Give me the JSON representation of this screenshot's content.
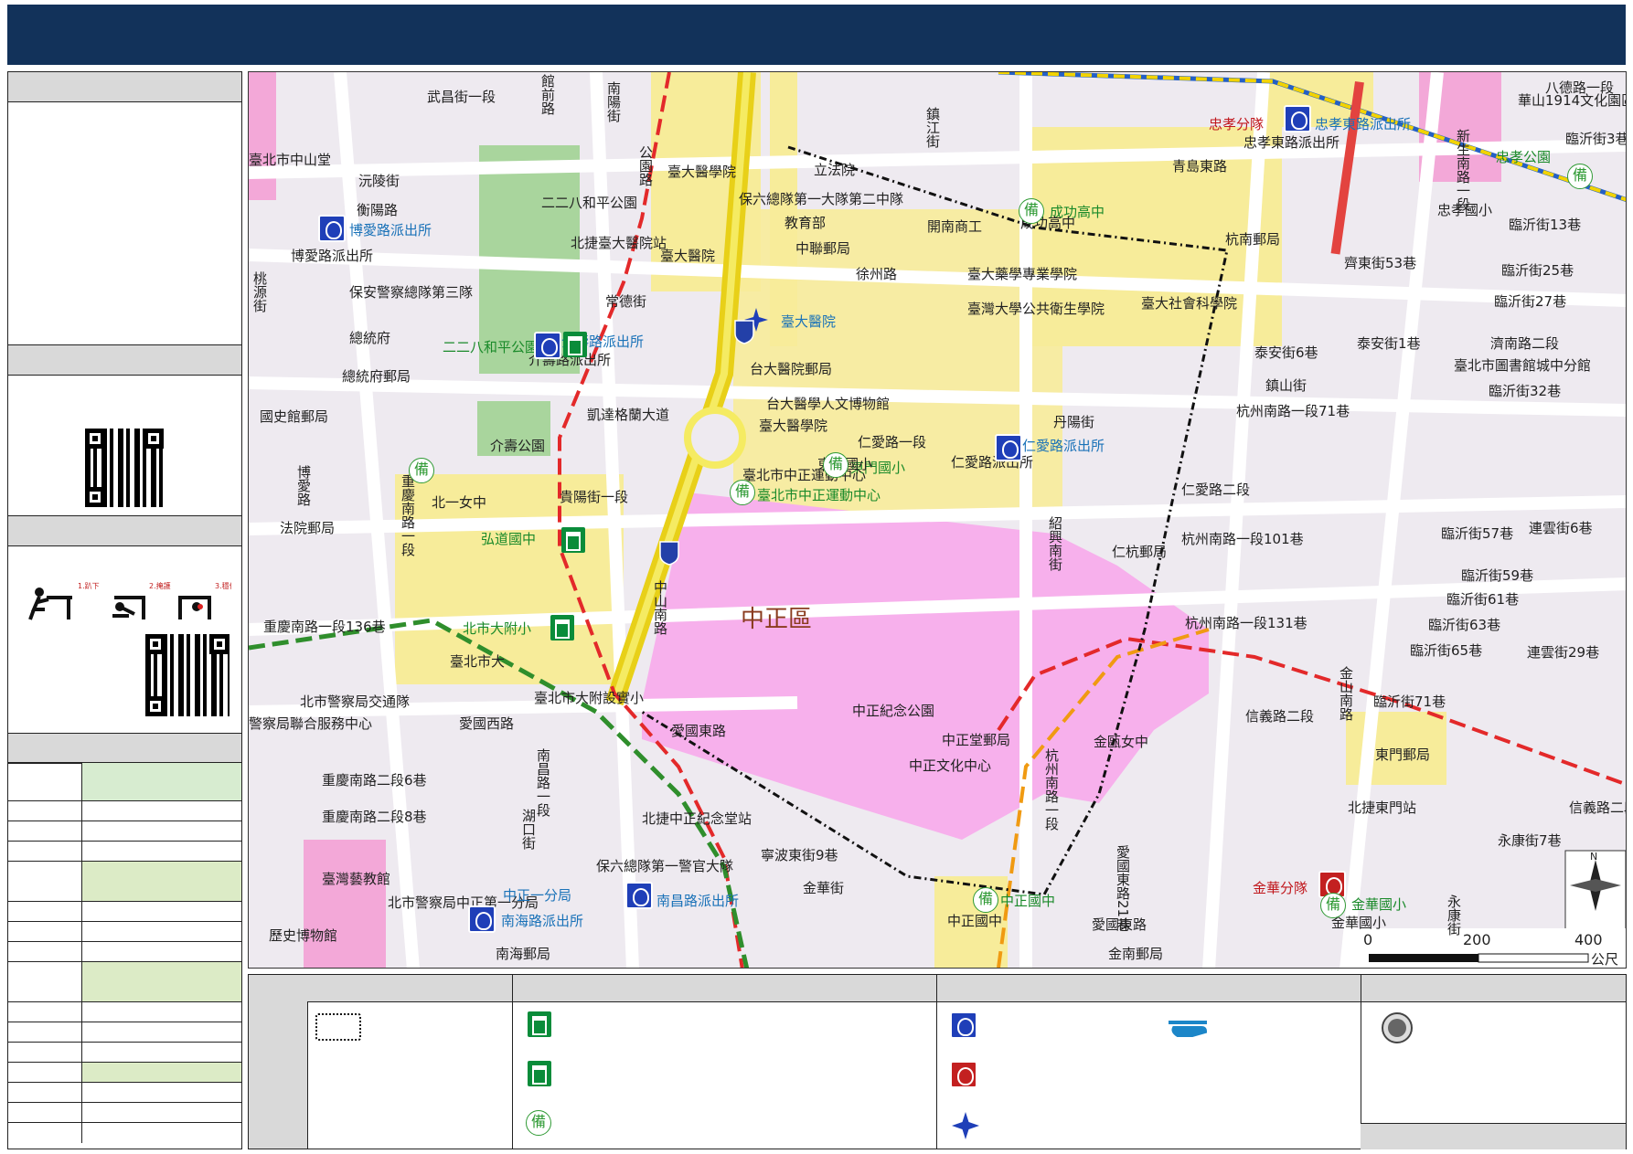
{
  "map": {
    "district": "中正區",
    "labels": [
      {
        "t": "武昌街一段"
      },
      {
        "t": "館前路"
      },
      {
        "t": "南陽街"
      },
      {
        "t": "公園路"
      },
      {
        "t": "臺北市中山堂"
      },
      {
        "t": "沅陵街"
      },
      {
        "t": "衡陽路"
      },
      {
        "t": "二二八和平公園"
      },
      {
        "t": "北捷臺大醫院站"
      },
      {
        "t": "臺大醫院"
      },
      {
        "t": "臺大醫學院"
      },
      {
        "t": "保六總隊第一大隊第二中隊"
      },
      {
        "t": "教育部"
      },
      {
        "t": "立法院"
      },
      {
        "t": "鎮江街"
      },
      {
        "t": "開南商工"
      },
      {
        "t": "中聯郵局"
      },
      {
        "t": "徐州路"
      },
      {
        "t": "臺大藥學專業學院"
      },
      {
        "t": "臺灣大學公共衛生學院"
      },
      {
        "t": "臺大社會科學院"
      },
      {
        "t": "青島東路"
      },
      {
        "t": "杭南郵局"
      },
      {
        "t": "華山1914文化園區"
      },
      {
        "t": "八德路一段"
      },
      {
        "t": "新生南路一段"
      },
      {
        "t": "臨沂街3巷"
      },
      {
        "t": "臨沂街13巷"
      },
      {
        "t": "臨沂街25巷"
      },
      {
        "t": "臨沂街27巷"
      },
      {
        "t": "齊東街53巷"
      },
      {
        "t": "忠孝公園"
      },
      {
        "t": "博愛路派出所"
      },
      {
        "t": "保安警察總隊第三隊"
      },
      {
        "t": "桃源街"
      },
      {
        "t": "總統府"
      },
      {
        "t": "總統府郵局"
      },
      {
        "t": "國史館郵局"
      },
      {
        "t": "介壽路派出所"
      },
      {
        "t": "介壽公園"
      },
      {
        "t": "凱達格蘭大道"
      },
      {
        "t": "常德街"
      },
      {
        "t": "台大醫院郵局"
      },
      {
        "t": "台大醫學人文博物館"
      },
      {
        "t": "臺大醫學院"
      },
      {
        "t": "仁愛路一段"
      },
      {
        "t": "丹陽街"
      },
      {
        "t": "金山南路"
      },
      {
        "t": "泰安街6巷"
      },
      {
        "t": "泰安街1巷"
      },
      {
        "t": "濟南路二段"
      },
      {
        "t": "臺北市圖書館城中分館"
      },
      {
        "t": "臨沂街32巷"
      },
      {
        "t": "杭州南路一段71巷"
      },
      {
        "t": "鎮山街"
      },
      {
        "t": "博愛路"
      },
      {
        "t": "北一女中"
      },
      {
        "t": "法院郵局"
      },
      {
        "t": "重慶南路一段"
      },
      {
        "t": "貴陽街一段"
      },
      {
        "t": "東門國小"
      },
      {
        "t": "臺北市中正運動中心"
      },
      {
        "t": "仁愛路二段"
      },
      {
        "t": "紹興南街"
      },
      {
        "t": "仁杭郵局"
      },
      {
        "t": "臨沂街57巷"
      },
      {
        "t": "連雲街6巷"
      },
      {
        "t": "杭州南路一段101巷"
      },
      {
        "t": "弘道國中"
      },
      {
        "t": "中山南路"
      },
      {
        "t": "北市大附小"
      },
      {
        "t": "臺北市大"
      },
      {
        "t": "重慶南路一段136巷"
      },
      {
        "t": "杭州南路一段131巷"
      },
      {
        "t": "臨沂街59巷"
      },
      {
        "t": "臨沂街61巷"
      },
      {
        "t": "臨沂街63巷"
      },
      {
        "t": "臨沂街65巷"
      },
      {
        "t": "連雲街29巷"
      },
      {
        "t": "臨沂街71巷"
      },
      {
        "t": "北市警察局交通隊"
      },
      {
        "t": "警察局聯合服務中心"
      },
      {
        "t": "臺北市大附設實小"
      },
      {
        "t": "愛國西路"
      },
      {
        "t": "愛國東路"
      },
      {
        "t": "中正紀念公園"
      },
      {
        "t": "中正堂郵局"
      },
      {
        "t": "中正文化中心"
      },
      {
        "t": "金甌女中"
      },
      {
        "t": "信義路二段"
      },
      {
        "t": "東門郵局"
      },
      {
        "t": "北捷東門站"
      },
      {
        "t": "信義路二段"
      },
      {
        "t": "永康街7巷"
      },
      {
        "t": "重慶南路二段6巷"
      },
      {
        "t": "重慶南路二段8巷"
      },
      {
        "t": "南昌路一段"
      },
      {
        "t": "湖口街"
      },
      {
        "t": "北捷中正紀念堂站"
      },
      {
        "t": "寧波東街9巷"
      },
      {
        "t": "金華街"
      },
      {
        "t": "愛國東路21巷"
      },
      {
        "t": "杭州南路一段"
      },
      {
        "t": "保六總隊第一警官大隊"
      },
      {
        "t": "臺灣藝教館"
      },
      {
        "t": "北市警察局中正第一分局"
      },
      {
        "t": "南昌路派出所"
      },
      {
        "t": "歷史博物館"
      },
      {
        "t": "南海路派出所"
      },
      {
        "t": "南海郵局"
      },
      {
        "t": "中正國中"
      },
      {
        "t": "中正國中"
      },
      {
        "t": "愛國東路"
      },
      {
        "t": "金南郵局"
      },
      {
        "t": "金華分隊"
      },
      {
        "t": "金華國小"
      },
      {
        "t": "金華國小"
      },
      {
        "t": "永康街"
      },
      {
        "t": "忠孝分隊"
      },
      {
        "t": "忠孝東路派出所"
      },
      {
        "t": "忠孝東路派出所"
      },
      {
        "t": "成功高中"
      },
      {
        "t": "成功高中"
      },
      {
        "t": "仁愛路派出所"
      },
      {
        "t": "仁愛路派出所"
      },
      {
        "t": "二二八和平公園"
      },
      {
        "t": "介壽路派出所"
      },
      {
        "t": "博愛路派出所"
      },
      {
        "t": "臺大醫院"
      },
      {
        "t": "忠孝國小"
      },
      {
        "t": "臺北市中正運動中心"
      },
      {
        "t": "東門國小"
      },
      {
        "t": "中正一分局"
      }
    ],
    "scale": {
      "ticks": [
        "0",
        "200",
        "400"
      ],
      "unit": "公尺"
    },
    "north": "N"
  },
  "legend": {
    "bei_symbol": "備"
  },
  "sidebar": {
    "drill_steps": [
      "1.趴下",
      "2.掩護",
      "3.穩住"
    ]
  }
}
